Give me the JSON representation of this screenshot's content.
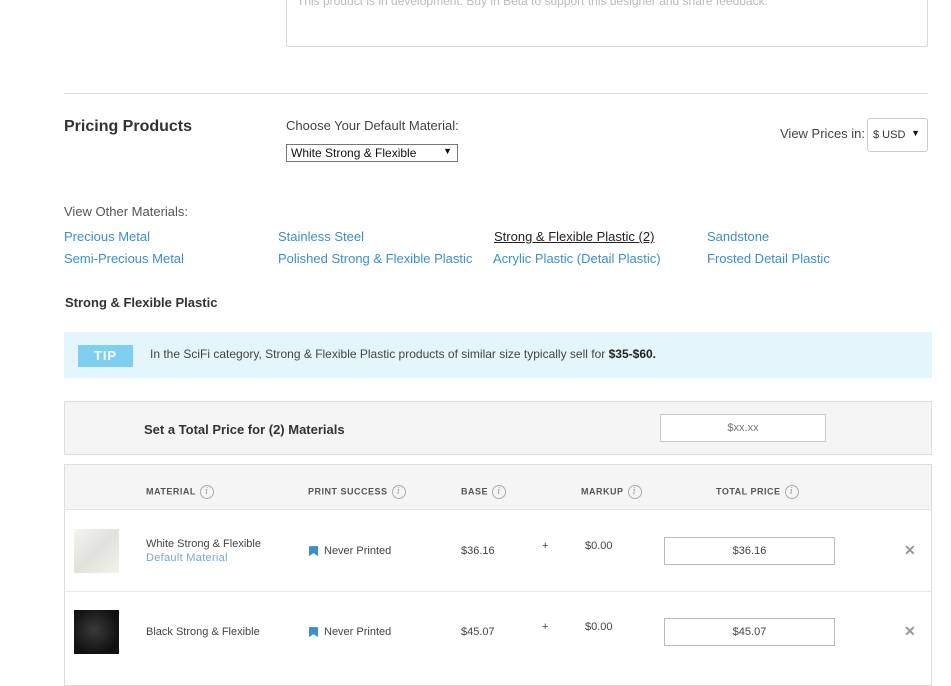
{
  "description": {
    "text": "This product is in development. Buy in Beta to support this designer and share feedback."
  },
  "pricing": {
    "title": "Pricing Products",
    "choose_label": "Choose Your Default Material:",
    "default_material": "White Strong & Flexible",
    "view_prices_label": "View Prices in:",
    "currency": "$ USD"
  },
  "other_materials": {
    "label": "View Other Materials:",
    "links": [
      "Precious Metal",
      "Semi-Precious Metal",
      "Stainless Steel",
      "Polished Strong & Flexible Plastic",
      "Strong & Flexible Plastic (2)",
      "Acrylic Plastic (Detail Plastic)",
      "Sandstone",
      "Frosted Detail Plastic"
    ]
  },
  "section": {
    "title": "Strong & Flexible Plastic"
  },
  "tip": {
    "badge": "TIP",
    "text": "In the SciFi category, Strong & Flexible Plastic products of similar size typically sell for ",
    "range": "$35-$60."
  },
  "total": {
    "label": "Set a Total Price for (2) Materials",
    "placeholder": "$xx.xx"
  },
  "table": {
    "headers": [
      "MATERIAL",
      "PRINT SUCCESS",
      "BASE",
      "MARKUP",
      "TOTAL PRICE"
    ],
    "info_glyph": "i",
    "plus": "+",
    "rows": [
      {
        "material": "White Strong & Flexible",
        "note": "Default Material",
        "print_success": "Never Printed",
        "base": "$36.16",
        "markup": "$0.00",
        "total": "$36.16"
      },
      {
        "material": "Black Strong & Flexible",
        "note": "",
        "print_success": "Never Printed",
        "base": "$45.07",
        "markup": "$0.00",
        "total": "$45.07"
      }
    ]
  },
  "icons": {
    "dropdown": "▼",
    "remove": "✕"
  },
  "colors": {
    "link": "#3d8ed1",
    "tip_background": "#e5f5fc",
    "tip_badge": "#7fcff0",
    "flag": "#3d8ed1"
  }
}
